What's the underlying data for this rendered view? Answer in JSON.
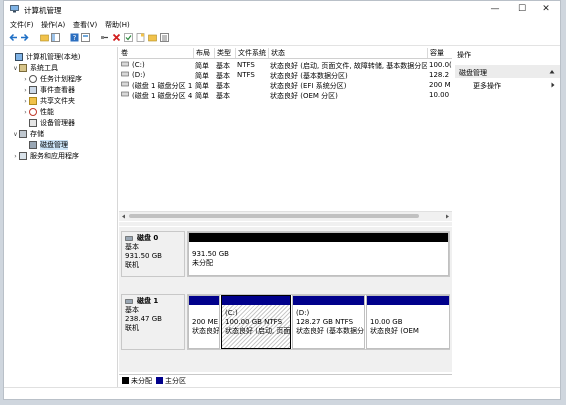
{
  "window": {
    "title": "计算机管理",
    "controls": [
      "—",
      "☐",
      "✕"
    ]
  },
  "menu": [
    "文件(F)",
    "操作(A)",
    "查看(V)",
    "帮助(H)"
  ],
  "toolbar_icons": [
    "back-arrow-icon",
    "forward-arrow-icon",
    "up-folder-icon",
    "show-tree-icon",
    "help-icon",
    "properties-icon",
    "connect-icon",
    "delete-icon",
    "check-icon",
    "new-icon",
    "export-icon",
    "list-icon"
  ],
  "tree": {
    "items": [
      {
        "label": "计算机管理(本地)",
        "level": 0,
        "expander": "",
        "icon": "computer-management-icon"
      },
      {
        "label": "系统工具",
        "level": 1,
        "expander": "∨",
        "icon": "tools-icon"
      },
      {
        "label": "任务计划程序",
        "level": 2,
        "expander": "›",
        "icon": "clock-icon"
      },
      {
        "label": "事件查看器",
        "level": 2,
        "expander": "›",
        "icon": "event-viewer-icon"
      },
      {
        "label": "共享文件夹",
        "level": 2,
        "expander": "›",
        "icon": "shared-folder-icon"
      },
      {
        "label": "性能",
        "level": 2,
        "expander": "›",
        "icon": "performance-icon"
      },
      {
        "label": "设备管理器",
        "level": 2,
        "expander": "",
        "icon": "device-manager-icon"
      },
      {
        "label": "存储",
        "level": 1,
        "expander": "∨",
        "icon": "storage-icon"
      },
      {
        "label": "磁盘管理",
        "level": 2,
        "expander": "",
        "icon": "disk-management-icon",
        "selected": true
      },
      {
        "label": "服务和应用程序",
        "level": 1,
        "expander": "›",
        "icon": "services-icon"
      }
    ]
  },
  "volumes": {
    "columns": [
      "卷",
      "布局",
      "类型",
      "文件系统",
      "状态",
      "容量"
    ],
    "rows": [
      [
        "(C:)",
        "简单",
        "基本",
        "NTFS",
        "状态良好 (启动, 页面文件, 故障转储, 基本数据分区)",
        "100.0("
      ],
      [
        "(D:)",
        "简单",
        "基本",
        "NTFS",
        "状态良好 (基本数据分区)",
        "128.2"
      ],
      [
        "(磁盘 1 磁盘分区 1)",
        "简单",
        "基本",
        "",
        "状态良好 (EFI 系统分区)",
        "200 M"
      ],
      [
        "(磁盘 1 磁盘分区 4)",
        "简单",
        "基本",
        "",
        "状态良好 (OEM 分区)",
        "10.00"
      ]
    ]
  },
  "disks": [
    {
      "name": "磁盘 0",
      "type": "基本",
      "size": "931.50 GB",
      "status": "联机",
      "partitions": [
        {
          "line1": "",
          "line2": "931.50 GB",
          "line3": "未分配",
          "kind": "unallocated"
        }
      ]
    },
    {
      "name": "磁盘 1",
      "type": "基本",
      "size": "238.47 GB",
      "status": "联机",
      "partitions": [
        {
          "line1": "",
          "line2": "200 ME",
          "line3": "状态良好",
          "kind": "primary"
        },
        {
          "line1": "(C:)",
          "line2": "100.00 GB NTFS",
          "line3": "状态良好 (启动, 页面",
          "kind": "primary",
          "selected": true
        },
        {
          "line1": "(D:)",
          "line2": "128.27 GB NTFS",
          "line3": "状态良好 (基本数据分",
          "kind": "primary"
        },
        {
          "line1": "",
          "line2": "10.00 GB",
          "line3": "状态良好 (OEM",
          "kind": "primary"
        }
      ]
    }
  ],
  "legend": [
    {
      "label": "未分配",
      "color": "#000000"
    },
    {
      "label": "主分区",
      "color": "#00008b"
    }
  ],
  "actions": {
    "header": "操作",
    "section": "磁盘管理",
    "more": "更多操作"
  },
  "colors": {
    "partition_header": "#00008b",
    "unallocated_header": "#000000",
    "selection": "#cce4f7"
  }
}
